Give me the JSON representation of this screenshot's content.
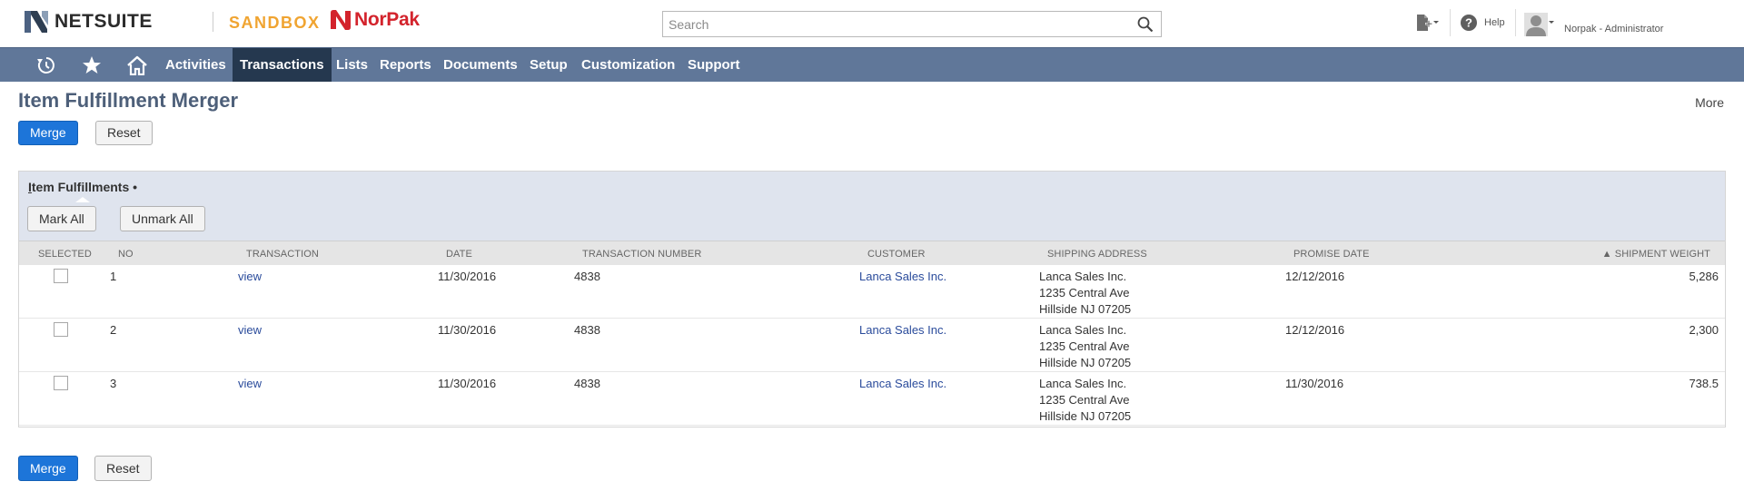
{
  "header": {
    "brand": "NETSUITE",
    "environment": "SANDBOX",
    "company": "NorPak",
    "search_placeholder": "Search",
    "help_label": "Help",
    "user_label": "Norpak - Administrator"
  },
  "nav": {
    "items": [
      {
        "label": "Activities"
      },
      {
        "label": "Transactions",
        "active": true
      },
      {
        "label": "Lists"
      },
      {
        "label": "Reports"
      },
      {
        "label": "Documents"
      },
      {
        "label": "Setup"
      },
      {
        "label": "Customization"
      },
      {
        "label": "Support"
      }
    ]
  },
  "page": {
    "title": "Item Fulfillment Merger",
    "more_label": "More",
    "merge_label": "Merge",
    "reset_label": "Reset"
  },
  "sublist": {
    "title_first": "I",
    "title_rest": "tem Fulfillments",
    "title_dot": "•",
    "mark_all_label": "Mark All",
    "unmark_all_label": "Unmark All",
    "columns": [
      "SELECTED",
      "NO",
      "TRANSACTION",
      "DATE",
      "TRANSACTION NUMBER",
      "CUSTOMER",
      "SHIPPING ADDRESS",
      "PROMISE DATE",
      "▲ SHIPMENT WEIGHT"
    ],
    "rows": [
      {
        "selected": false,
        "no": "1",
        "transaction": "view",
        "date": "11/30/2016",
        "number": "4838",
        "customer": "Lanca Sales Inc.",
        "address": [
          "Lanca Sales Inc.",
          "1235 Central Ave",
          "Hillside NJ 07205"
        ],
        "promise_date": "12/12/2016",
        "weight": "5,286"
      },
      {
        "selected": false,
        "no": "2",
        "transaction": "view",
        "date": "11/30/2016",
        "number": "4838",
        "customer": "Lanca Sales Inc.",
        "address": [
          "Lanca Sales Inc.",
          "1235 Central Ave",
          "Hillside NJ 07205"
        ],
        "promise_date": "12/12/2016",
        "weight": "2,300"
      },
      {
        "selected": false,
        "no": "3",
        "transaction": "view",
        "date": "11/30/2016",
        "number": "4838",
        "customer": "Lanca Sales Inc.",
        "address": [
          "Lanca Sales Inc.",
          "1235 Central Ave",
          "Hillside NJ 07205"
        ],
        "promise_date": "11/30/2016",
        "weight": "738.5"
      }
    ]
  },
  "colors": {
    "nav_bg": "#607799",
    "nav_active": "#25384f",
    "primary_button": "#1d75d9",
    "title": "#4d5f79",
    "sandbox": "#f0a431",
    "norpak": "#d3232c",
    "link": "#2a4b9b"
  },
  "icons": {
    "recent": "history-icon",
    "favorites": "star-icon",
    "home": "home-icon",
    "create": "create-new-icon",
    "help": "help-icon",
    "user": "user-avatar-icon",
    "search": "search-icon"
  }
}
